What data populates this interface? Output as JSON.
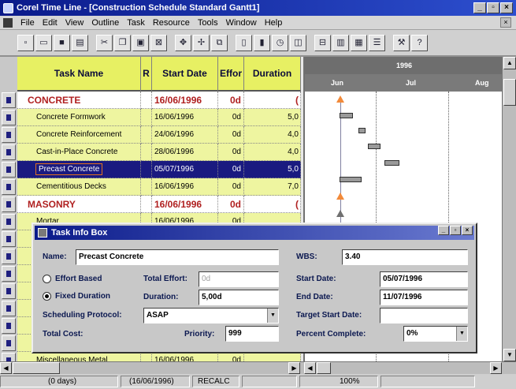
{
  "window": {
    "title": "Corel Time Line - [Construction Schedule Standard Gantt1]"
  },
  "menu": [
    "File",
    "Edit",
    "View",
    "Outline",
    "Task",
    "Resource",
    "Tools",
    "Window",
    "Help"
  ],
  "toolbar": [
    "new",
    "open",
    "save",
    "print",
    "cut",
    "copy",
    "paste",
    "find",
    "indent",
    "outdent",
    "link",
    "gantt",
    "pert",
    "calendar",
    "chart",
    "cost",
    "histogram",
    "table",
    "report",
    "help"
  ],
  "grid": {
    "headers": {
      "name": "Task Name",
      "r": "R",
      "start": "Start Date",
      "effort": "Effor",
      "duration": "Duration"
    },
    "rows": [
      {
        "name": "CONCRETE",
        "start": "16/06/1996",
        "effort": "0d",
        "duration": "(",
        "summary": true
      },
      {
        "name": "Concrete Formwork",
        "start": "16/06/1996",
        "effort": "0d",
        "duration": "5,0"
      },
      {
        "name": "Concrete Reinforcement",
        "start": "24/06/1996",
        "effort": "0d",
        "duration": "4,0"
      },
      {
        "name": "Cast-in-Place Concrete",
        "start": "28/06/1996",
        "effort": "0d",
        "duration": "4,0"
      },
      {
        "name": "Precast Concrete",
        "start": "05/07/1996",
        "effort": "0d",
        "duration": "5,0",
        "selected": true
      },
      {
        "name": "Cementitious Decks",
        "start": "16/06/1996",
        "effort": "0d",
        "duration": "7,0"
      },
      {
        "name": "MASONRY",
        "start": "16/06/1996",
        "effort": "0d",
        "duration": "(",
        "summary": true
      },
      {
        "name": "Mortar",
        "start": "16/06/1996",
        "effort": "0d",
        "duration": ""
      },
      {
        "name": "",
        "start": "",
        "effort": "",
        "duration": ""
      },
      {
        "name": "",
        "start": "",
        "effort": "",
        "duration": ""
      },
      {
        "name": "",
        "start": "",
        "effort": "",
        "duration": ""
      },
      {
        "name": "",
        "start": "",
        "effort": "",
        "duration": ""
      },
      {
        "name": "",
        "start": "",
        "effort": "",
        "duration": ""
      },
      {
        "name": "",
        "start": "",
        "effort": "",
        "duration": ""
      },
      {
        "name": "",
        "start": "",
        "effort": "",
        "duration": ""
      },
      {
        "name": "Miscellaneous Metal",
        "start": "16/06/1996",
        "effort": "0d",
        "duration": ""
      }
    ]
  },
  "gantt": {
    "year": "1996",
    "months": [
      "Jun",
      "Jul",
      "Aug"
    ]
  },
  "dialog": {
    "title": "Task Info Box",
    "name_label": "Name:",
    "name_value": "Precast Concrete",
    "wbs_label": "WBS:",
    "wbs_value": "3.40",
    "effort_based": "Effort Based",
    "fixed_duration": "Fixed Duration",
    "total_effort_label": "Total Effort:",
    "total_effort_value": "0d",
    "duration_label": "Duration:",
    "duration_value": "5,00d",
    "start_label": "Start Date:",
    "start_value": "05/07/1996",
    "end_label": "End Date:",
    "end_value": "11/07/1996",
    "protocol_label": "Scheduling Protocol:",
    "protocol_value": "ASAP",
    "target_label": "Target Start Date:",
    "target_value": "",
    "cost_label": "Total Cost:",
    "priority_label": "Priority:",
    "priority_value": "999",
    "percent_label": "Percent Complete:",
    "percent_value": "0%"
  },
  "status": {
    "days": "(0 days)",
    "date": "(16/06/1996)",
    "mode": "RECALC",
    "zoom": "100%"
  }
}
